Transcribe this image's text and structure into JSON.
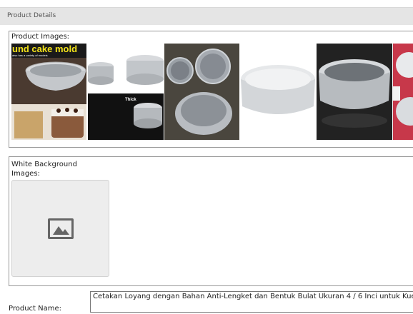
{
  "panel": {
    "title": "Product Details"
  },
  "product_images": {
    "label": "Product Images:",
    "thumbnails": [
      {
        "name": "cake-mold-collage",
        "overlay_text": "und cake mold",
        "sub_text": "also has a variety of models"
      },
      {
        "name": "round-pan-sizes",
        "overlay_text": "Thick"
      },
      {
        "name": "three-round-pans"
      },
      {
        "name": "single-pan-white"
      },
      {
        "name": "silver-pan-dark"
      },
      {
        "name": "pan-red-background"
      }
    ]
  },
  "white_background": {
    "label": "White Background Images:",
    "placeholder_icon": "image-placeholder-icon"
  },
  "product_name": {
    "label": "Product Name:",
    "value": "Cetakan Loyang dengan Bahan Anti-Lengket dan Bentuk Bulat Ukuran 4 / 6 Inci untuk Kue"
  }
}
